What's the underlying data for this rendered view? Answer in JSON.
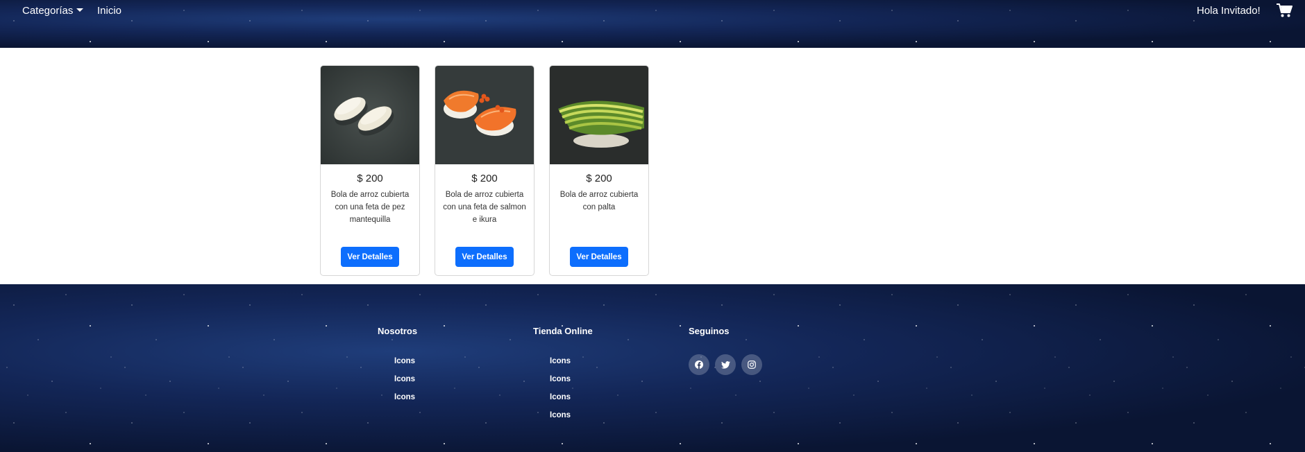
{
  "navbar": {
    "categories_label": "Categorías",
    "home_label": "Inicio",
    "greeting": "Hola Invitado!",
    "cart_icon": "shopping-cart-icon"
  },
  "products": [
    {
      "price": "$ 200",
      "description": "Bola de arroz cubierta con una feta de pez mantequilla",
      "button_label": "Ver Detalles",
      "image": "nigiri-butterfish"
    },
    {
      "price": "$ 200",
      "description": "Bola de arroz cubierta con una feta de salmon e ikura",
      "button_label": "Ver Detalles",
      "image": "nigiri-salmon-ikura"
    },
    {
      "price": "$ 200",
      "description": "Bola de arroz cubierta con palta",
      "button_label": "Ver Detalles",
      "image": "nigiri-avocado"
    }
  ],
  "footer": {
    "columns": [
      {
        "heading": "Nosotros",
        "items": [
          "Icons",
          "Icons",
          "Icons"
        ]
      },
      {
        "heading": "Tienda Online",
        "items": [
          "Icons",
          "Icons",
          "Icons",
          "Icons"
        ]
      },
      {
        "heading": "Seguinos",
        "social": [
          "facebook-icon",
          "twitter-icon",
          "instagram-icon"
        ]
      }
    ]
  },
  "colors": {
    "primary_button": "#0d6efd",
    "space_background": "#0b1736"
  }
}
